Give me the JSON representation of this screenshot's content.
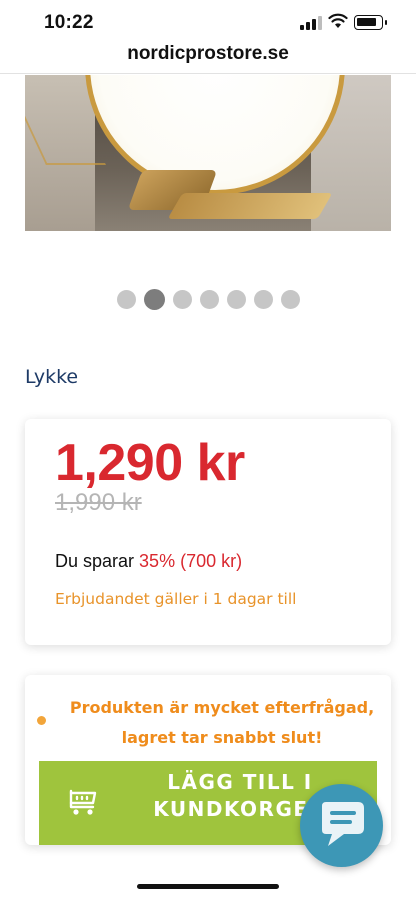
{
  "status_bar": {
    "time": "10:22"
  },
  "browser": {
    "url": "nordicprostore.se"
  },
  "carousel": {
    "dot_count": 7,
    "active_index": 1
  },
  "product": {
    "brand": "Lykke",
    "price": "1,290 kr",
    "old_price": "1,990 kr",
    "savings_prefix": "Du sparar ",
    "savings_value": "35% (700 kr)",
    "offer_text": "Erbjudandet gäller i 1 dagar till"
  },
  "stock": {
    "warning_line1": "Produkten är mycket efterfrågad,",
    "warning_line2": "lagret tar snabbt slut!"
  },
  "cart": {
    "add_label_line1": "LÄGG TILL I",
    "add_label_line2": "KUNDKORGEN"
  },
  "colors": {
    "price_red": "#d9282f",
    "offer_orange": "#e8932a",
    "button_green": "#9fc43d",
    "brand_blue": "#1d3a66",
    "chat_blue": "#3d97b6"
  },
  "icons": [
    "signal-icon",
    "wifi-icon",
    "battery-icon",
    "cart-icon",
    "chat-icon"
  ]
}
